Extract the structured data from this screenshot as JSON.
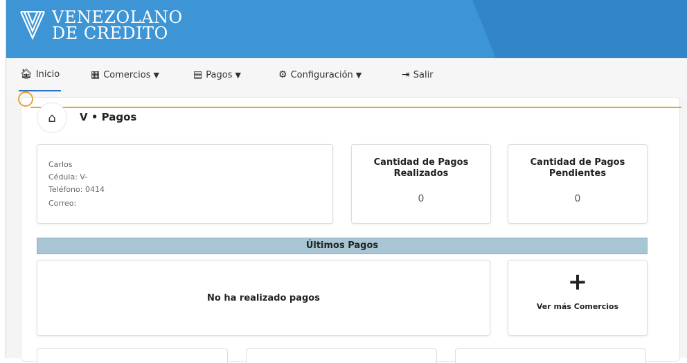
{
  "brand": {
    "line1": "VENEZOLANO",
    "line2": "DE CREDITO"
  },
  "nav": [
    {
      "label": "Inicio",
      "icon": "home-icon",
      "glyph": "🏠︎",
      "has_dropdown": false,
      "active": true
    },
    {
      "label": "Comercios",
      "icon": "building-icon",
      "glyph": "▦",
      "has_dropdown": true,
      "active": false
    },
    {
      "label": "Pagos",
      "icon": "invoice-icon",
      "glyph": "▤",
      "has_dropdown": true,
      "active": false
    },
    {
      "label": "Configuración",
      "icon": "cog-icon",
      "glyph": "⚙",
      "has_dropdown": true,
      "active": false
    },
    {
      "label": "Salir",
      "icon": "sign-out-icon",
      "glyph": "⇥",
      "has_dropdown": false,
      "active": false
    }
  ],
  "breadcrumb": {
    "title": "V • Pagos",
    "home_glyph": "⌂"
  },
  "profile": {
    "name": "Carlos",
    "cedula": "Cédula: V-",
    "telefono": "Teléfono: 0414",
    "correo": "Correo:"
  },
  "stats": [
    {
      "title": "Cantidad de Pagos Realizados",
      "value": "0"
    },
    {
      "title": "Cantidad de Pagos Pendientes",
      "value": "0"
    }
  ],
  "latest_payments": {
    "header": "Últimos Pagos",
    "empty_message": "No ha realizado pagos"
  },
  "more_merchants": {
    "plus": "+",
    "label": "Ver más Comercios"
  },
  "colors": {
    "header": "#3d95d6",
    "accent": "#2d74c4",
    "section_bar": "#a7c5d2",
    "annotation": "#e8a23a"
  }
}
